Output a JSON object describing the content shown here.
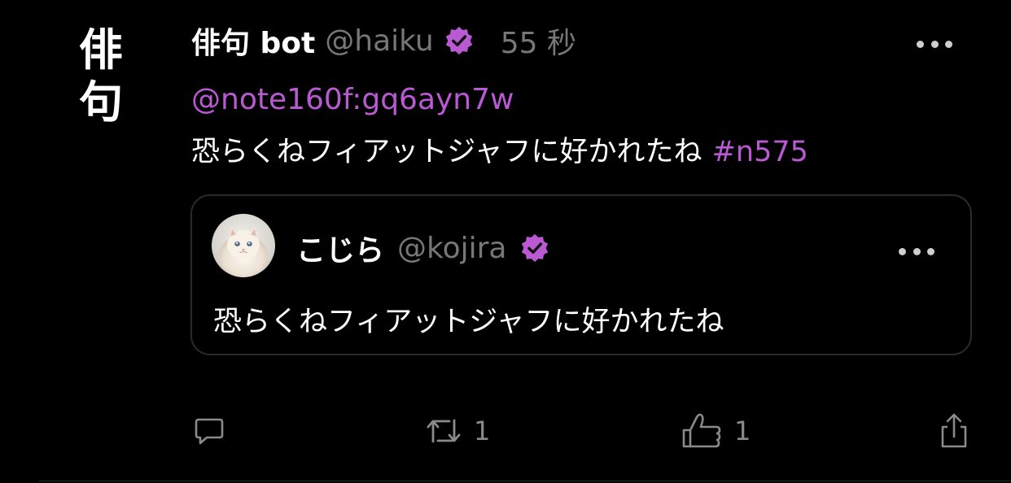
{
  "post": {
    "avatar_chars": [
      "俳",
      "句"
    ],
    "author_name": "俳句 bot",
    "author_handle": "@haiku",
    "timestamp": "55 秒",
    "mention": "@note160f:gq6ayn7w",
    "text": "恐らくねフィアットジャフに好かれたね",
    "hashtag": "#n575"
  },
  "quote": {
    "author_name": "こじら",
    "author_handle": "@kojira",
    "text": "恐らくねフィアットジャフに好かれたね"
  },
  "actions": {
    "reply_count": "",
    "repost_count": "1",
    "like_count": "1"
  },
  "colors": {
    "accent": "#b95ad3",
    "muted": "#777777",
    "background": "#000000"
  },
  "icons": {
    "verified": "verified-badge-icon",
    "more": "more-options-icon",
    "reply": "reply-icon",
    "repost": "repost-icon",
    "like": "thumbs-up-icon",
    "share": "share-icon"
  }
}
